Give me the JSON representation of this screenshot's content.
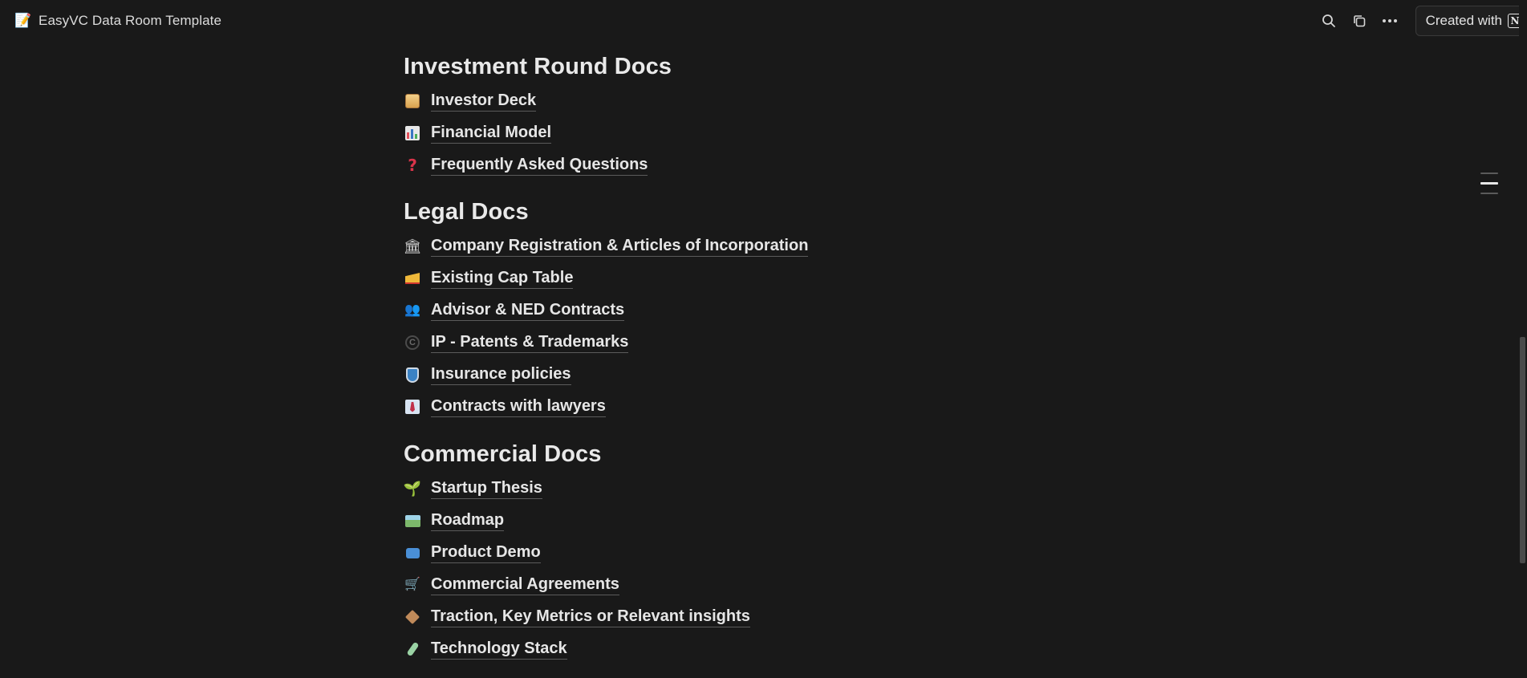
{
  "window": {
    "title": "EasyVC Data Room Template",
    "page_icon": "memo-icon"
  },
  "toolbar": {
    "search_icon": "search-icon",
    "duplicate_icon": "duplicate-icon",
    "more_icon": "more-icon",
    "created_with_label": "Created with",
    "brand_logo": "notion-logo-icon"
  },
  "sections": [
    {
      "heading": "Investment Round Docs",
      "items": [
        {
          "label": "Investor Deck",
          "icon": "scroll-icon"
        },
        {
          "label": "Financial Model",
          "icon": "bar-chart-icon"
        },
        {
          "label": "Frequently Asked Questions",
          "icon": "question-mark-icon"
        }
      ]
    },
    {
      "heading": "Legal Docs",
      "items": [
        {
          "label": "Company Registration & Articles of Incorporation",
          "icon": "classical-building-icon"
        },
        {
          "label": "Existing Cap Table",
          "icon": "cheese-wedge-icon"
        },
        {
          "label": "Advisor & NED Contracts",
          "icon": "people-icon"
        },
        {
          "label": "IP - Patents & Trademarks",
          "icon": "copyright-icon"
        },
        {
          "label": "Insurance policies",
          "icon": "shield-icon"
        },
        {
          "label": "Contracts with lawyers",
          "icon": "necktie-icon"
        }
      ]
    },
    {
      "heading": "Commercial Docs",
      "items": [
        {
          "label": "Startup Thesis",
          "icon": "seedling-icon"
        },
        {
          "label": "Roadmap",
          "icon": "motorway-icon"
        },
        {
          "label": "Product Demo",
          "icon": "television-icon"
        },
        {
          "label": "Commercial Agreements",
          "icon": "shopping-cart-icon"
        },
        {
          "label": "Traction, Key Metrics or Relevant insights",
          "icon": "package-icon"
        },
        {
          "label": "Technology Stack",
          "icon": "test-tube-icon"
        }
      ]
    }
  ],
  "colors": {
    "background": "#191919",
    "text": "#e6e6e6",
    "link_underline": "#5b5b5b"
  }
}
